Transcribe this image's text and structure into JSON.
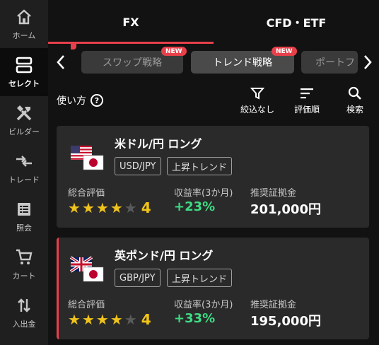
{
  "sidebar": {
    "items": [
      {
        "label": "ホーム",
        "icon": "home-icon"
      },
      {
        "label": "セレクト",
        "icon": "select-icon",
        "active": true
      },
      {
        "label": "ビルダー",
        "icon": "builder-tools-icon"
      },
      {
        "label": "トレード",
        "icon": "trade-arrows-icon"
      },
      {
        "label": "照会",
        "icon": "list-icon"
      },
      {
        "label": "カート",
        "icon": "cart-icon"
      },
      {
        "label": "入出金",
        "icon": "transfer-icon"
      }
    ]
  },
  "tabs": [
    {
      "label": "FX",
      "active": true
    },
    {
      "label": "CFD・ETF",
      "active": false
    }
  ],
  "chips": [
    {
      "label": "スワップ戦略",
      "badge": "NEW",
      "active": false
    },
    {
      "label": "トレンド戦略",
      "badge": "NEW",
      "active": true
    },
    {
      "label": "ポートフ",
      "active": false
    }
  ],
  "toolbar": {
    "howto": "使い方",
    "filter": "絞込なし",
    "sort": "評価順",
    "search": "検索"
  },
  "cards": [
    {
      "title": "米ドル/円 ロング",
      "pair": "USD/JPY",
      "trend": "上昇トレンド",
      "rating_label": "総合評価",
      "rating": "4",
      "stars_filled": 4,
      "stars_total": 5,
      "return_label": "収益率(3か月)",
      "return_value": "+23%",
      "margin_label": "推奨証拠金",
      "margin_value": "201,000円",
      "flag": "us-jp-flags"
    },
    {
      "title": "英ポンド/円 ロング",
      "pair": "GBP/JPY",
      "trend": "上昇トレンド",
      "rating_label": "総合評価",
      "rating": "4",
      "stars_filled": 4,
      "stars_total": 5,
      "return_label": "収益率(3か月)",
      "return_value": "+33%",
      "margin_label": "推奨証拠金",
      "margin_value": "195,000円",
      "flag": "gb-jp-flags"
    }
  ],
  "colors": {
    "accent": "#e8404a",
    "positive": "#3ddc84",
    "star": "#f0c41b",
    "card_bg": "#2a2a2a"
  }
}
